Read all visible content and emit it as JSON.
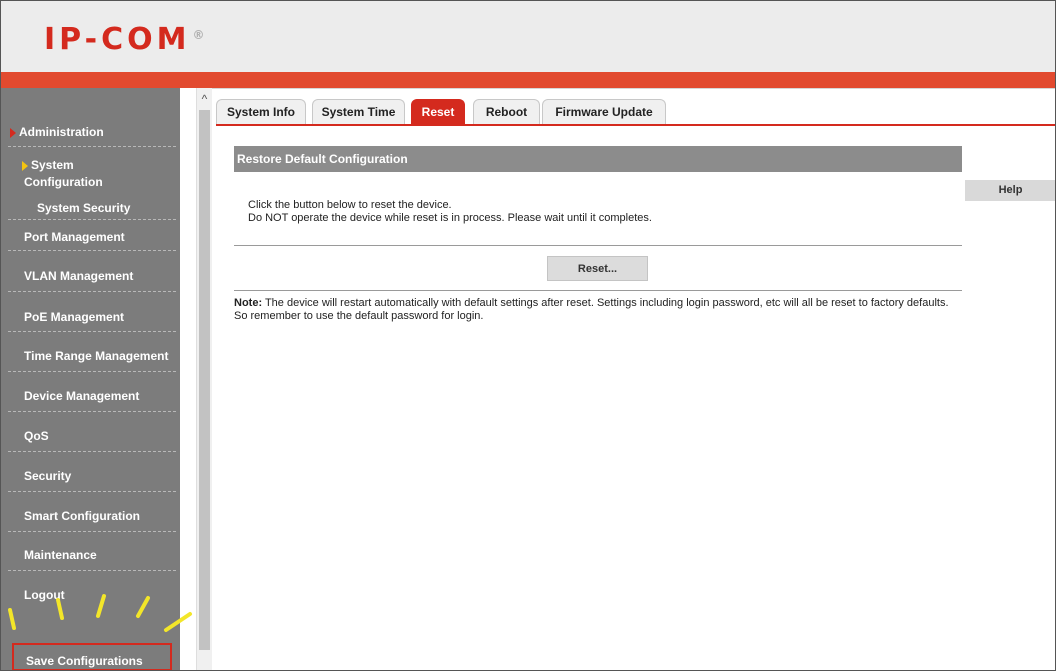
{
  "header": {
    "logo_text": "IP-COM",
    "logo_mark": "®"
  },
  "sidebar": {
    "items": [
      {
        "label": "Administration"
      },
      {
        "label": "System"
      },
      {
        "label": "Configuration"
      },
      {
        "label": "System Security"
      },
      {
        "label": "Port Management"
      },
      {
        "label": "VLAN Management"
      },
      {
        "label": "PoE Management"
      },
      {
        "label": "Time Range Management"
      },
      {
        "label": "Device Management"
      },
      {
        "label": "QoS"
      },
      {
        "label": "Security"
      },
      {
        "label": "Smart Configuration"
      },
      {
        "label": "Maintenance"
      },
      {
        "label": "Logout"
      }
    ],
    "save_label": "Save Configurations",
    "scroll_up_icon": "^"
  },
  "tabs": [
    {
      "label": "System Info"
    },
    {
      "label": "System Time"
    },
    {
      "label": "Reset",
      "active": true
    },
    {
      "label": "Reboot"
    },
    {
      "label": "Firmware Update"
    }
  ],
  "content": {
    "panel_title": "Restore Default Configuration",
    "help_label": "Help",
    "instruction_1": "Click the button below to reset the device.",
    "instruction_2": "Do NOT operate the device while reset is in process. Please wait until it completes.",
    "reset_button": "Reset...",
    "note_label": "Note:",
    "note_text": " The device will restart automatically with default settings after reset. Settings including login password, etc will all be reset to factory defaults. So remember to use the default password for login."
  },
  "colors": {
    "accent": "#d42a1e",
    "header_bar": "#e24a2f",
    "sidebar_bg": "#7c7c7c",
    "annotation": "#f3e629"
  }
}
